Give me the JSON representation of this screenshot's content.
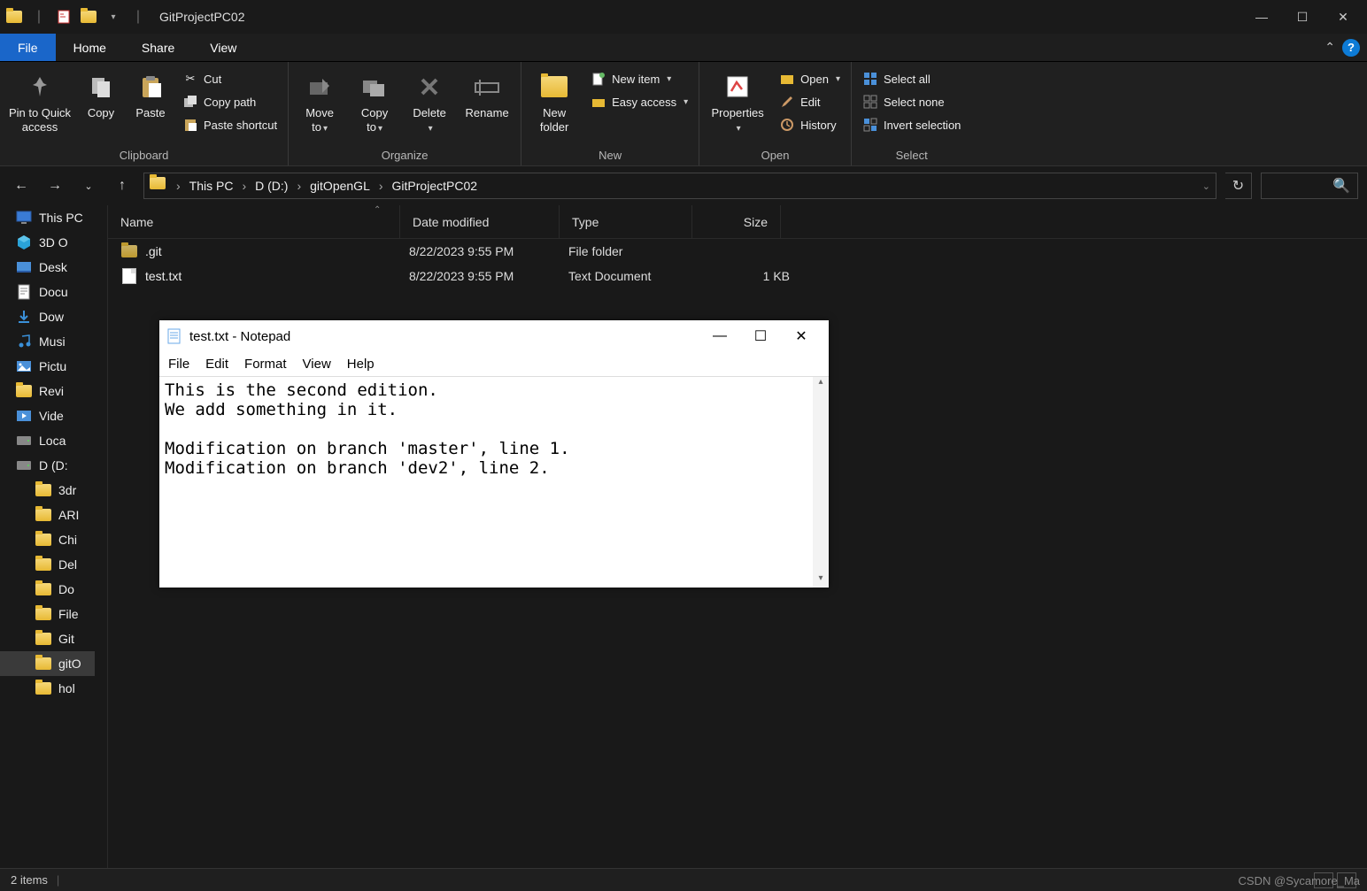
{
  "window": {
    "title": "GitProjectPC02",
    "minimize": "—",
    "maximize": "☐",
    "close": "✕"
  },
  "tabs": {
    "file": "File",
    "home": "Home",
    "share": "Share",
    "view": "View"
  },
  "ribbon": {
    "clipboard": {
      "label": "Clipboard",
      "pin": "Pin to Quick\naccess",
      "copy": "Copy",
      "paste": "Paste",
      "cut": "Cut",
      "copypath": "Copy path",
      "pastesc": "Paste shortcut"
    },
    "organize": {
      "label": "Organize",
      "moveto": "Move\nto",
      "copyto": "Copy\nto",
      "delete": "Delete",
      "rename": "Rename"
    },
    "new": {
      "label": "New",
      "newfolder": "New\nfolder",
      "newitem": "New item",
      "easyaccess": "Easy access"
    },
    "open": {
      "label": "Open",
      "properties": "Properties",
      "open": "Open",
      "edit": "Edit",
      "history": "History"
    },
    "select": {
      "label": "Select",
      "selectall": "Select all",
      "selectnone": "Select none",
      "invert": "Invert selection"
    }
  },
  "breadcrumb": {
    "thispc": "This PC",
    "drive": "D (D:)",
    "folder1": "gitOpenGL",
    "folder2": "GitProjectPC02",
    "sep": "›"
  },
  "columns": {
    "name": "Name",
    "date": "Date modified",
    "type": "Type",
    "size": "Size"
  },
  "sidebar": [
    {
      "icon": "monitor",
      "label": "This PC",
      "indent": false
    },
    {
      "icon": "cube3d",
      "label": "3D O",
      "indent": false
    },
    {
      "icon": "desk",
      "label": "Desk",
      "indent": false
    },
    {
      "icon": "doc",
      "label": "Docu",
      "indent": false
    },
    {
      "icon": "download",
      "label": "Dow",
      "indent": false
    },
    {
      "icon": "music",
      "label": "Musi",
      "indent": false
    },
    {
      "icon": "pic",
      "label": "Pictu",
      "indent": false
    },
    {
      "icon": "folder",
      "label": "Revi",
      "indent": false
    },
    {
      "icon": "video",
      "label": "Vide",
      "indent": false
    },
    {
      "icon": "drive",
      "label": "Loca",
      "indent": false
    },
    {
      "icon": "drive",
      "label": "D (D:",
      "indent": false
    },
    {
      "icon": "folder",
      "label": "3dr",
      "indent": true
    },
    {
      "icon": "folder",
      "label": "ARI",
      "indent": true
    },
    {
      "icon": "folder",
      "label": "Chi",
      "indent": true
    },
    {
      "icon": "folder",
      "label": "Del",
      "indent": true
    },
    {
      "icon": "folder",
      "label": "Do",
      "indent": true
    },
    {
      "icon": "folder",
      "label": "File",
      "indent": true
    },
    {
      "icon": "folder",
      "label": "Git",
      "indent": true
    },
    {
      "icon": "folder",
      "label": "gitO",
      "indent": true,
      "selected": true
    },
    {
      "icon": "folder",
      "label": "hol",
      "indent": true
    }
  ],
  "files": [
    {
      "icon": "folder",
      "name": ".git",
      "date": "8/22/2023 9:55 PM",
      "type": "File folder",
      "size": ""
    },
    {
      "icon": "file",
      "name": "test.txt",
      "date": "8/22/2023 9:55 PM",
      "type": "Text Document",
      "size": "1 KB"
    }
  ],
  "status": {
    "items": "2 items"
  },
  "notepad": {
    "title": "test.txt - Notepad",
    "menu": {
      "file": "File",
      "edit": "Edit",
      "format": "Format",
      "view": "View",
      "help": "Help"
    },
    "content": "This is the second edition.\nWe add something in it.\n\nModification on branch 'master', line 1.\nModification on branch 'dev2', line 2."
  },
  "watermark": "CSDN @Sycamore_Ma"
}
